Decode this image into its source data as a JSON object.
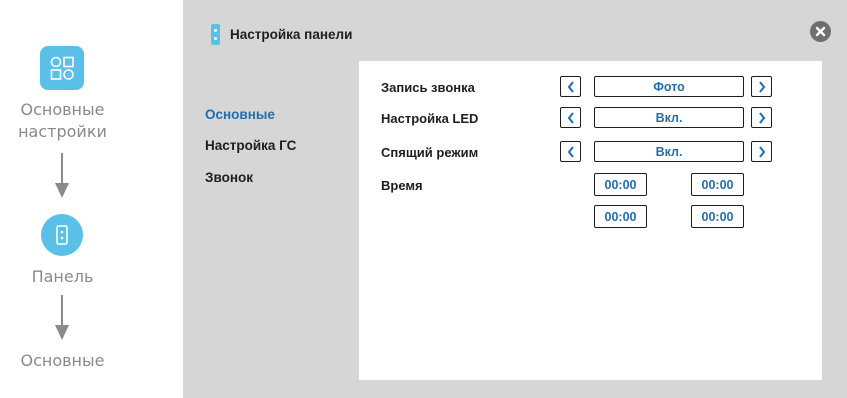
{
  "flow": {
    "step1_label_line1": "Основные",
    "step1_label_line2": "настройки",
    "step2_label": "Панель",
    "step3_label": "Основные",
    "icon_color": "#5bc0e8"
  },
  "panel": {
    "title": "Настройка панели",
    "close_icon": "close-icon",
    "nav": {
      "items": [
        {
          "label": "Основные",
          "active": true
        },
        {
          "label": "Настройка ГС",
          "active": false
        },
        {
          "label": "Звонок",
          "active": false
        }
      ]
    },
    "settings": {
      "rows": [
        {
          "label": "Запись звонка",
          "value": "Фото"
        },
        {
          "label": "Настройка LED",
          "value": "Вкл."
        },
        {
          "label": "Спящий режим",
          "value": "Вкл."
        }
      ],
      "time": {
        "label": "Время",
        "values": [
          "00:00",
          "00:00",
          "00:00",
          "00:00"
        ]
      }
    }
  },
  "colors": {
    "accent": "#1f6fb0",
    "panel_bg": "#d6d6d6",
    "flow_text": "#8a8a8a"
  }
}
